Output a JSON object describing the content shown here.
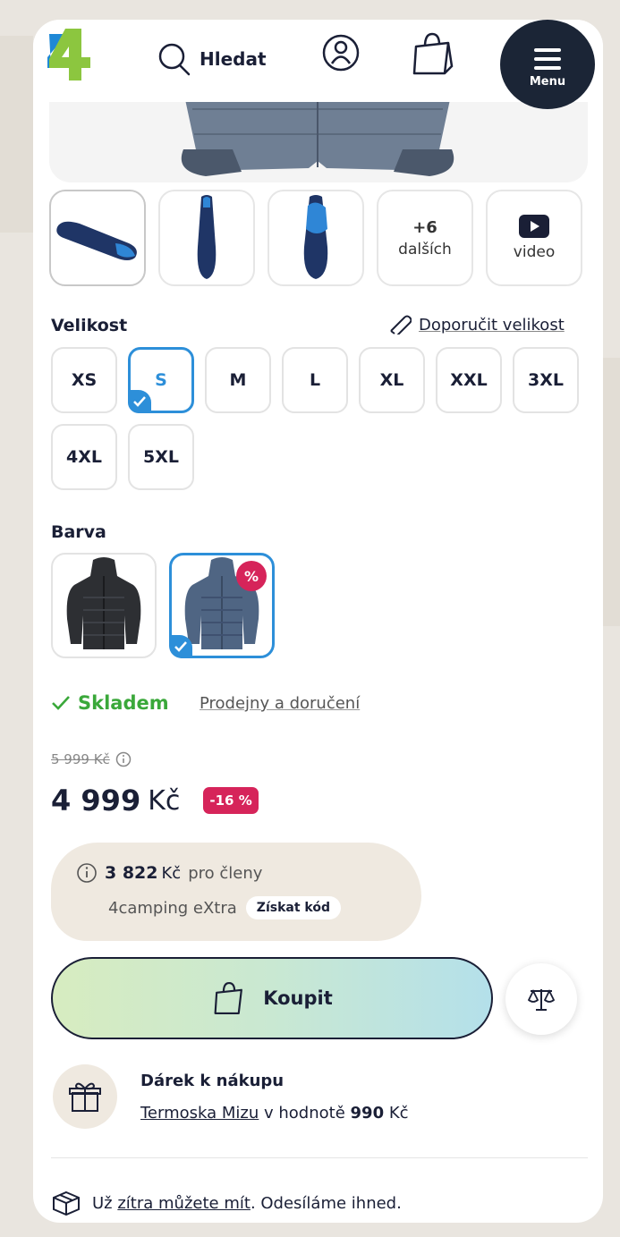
{
  "header": {
    "search_label": "Hledat",
    "menu_label": "Menu"
  },
  "gallery": {
    "more_count": "+6",
    "more_label": "dalších",
    "video_label": "video"
  },
  "size": {
    "label": "Velikost",
    "recommend_link": "Doporučit velikost",
    "options": [
      "XS",
      "S",
      "M",
      "L",
      "XL",
      "XXL",
      "3XL",
      "4XL",
      "5XL"
    ],
    "selected": "S"
  },
  "color": {
    "label": "Barva",
    "discount_marker": "%"
  },
  "stock": {
    "status": "Skladem",
    "stores_link": "Prodejny a doručení"
  },
  "price": {
    "old": "5 999 Kč",
    "current": "4 999",
    "currency": "Kč",
    "discount": "-16 %"
  },
  "member": {
    "price": "3 822",
    "currency": "Kč",
    "for_members": "pro členy",
    "program": "4camping eXtra",
    "get_code": "Získat kód"
  },
  "buy": {
    "label": "Koupit"
  },
  "gift": {
    "title": "Dárek k nákupu",
    "item_link": "Termoska Mizu",
    "value_prefix": "v hodnotě",
    "value": "990",
    "currency": "Kč"
  },
  "shipping": {
    "prefix": "Už",
    "link": "zítra můžete mít",
    "suffix": ". Odesíláme ihned."
  },
  "colors": {
    "accent": "#2d8fd9",
    "menu_bg": "#1b2536",
    "discount": "#d6245a",
    "in_stock": "#3aa83a",
    "logo_blue": "#1e88d6",
    "logo_green": "#8cc63f"
  }
}
